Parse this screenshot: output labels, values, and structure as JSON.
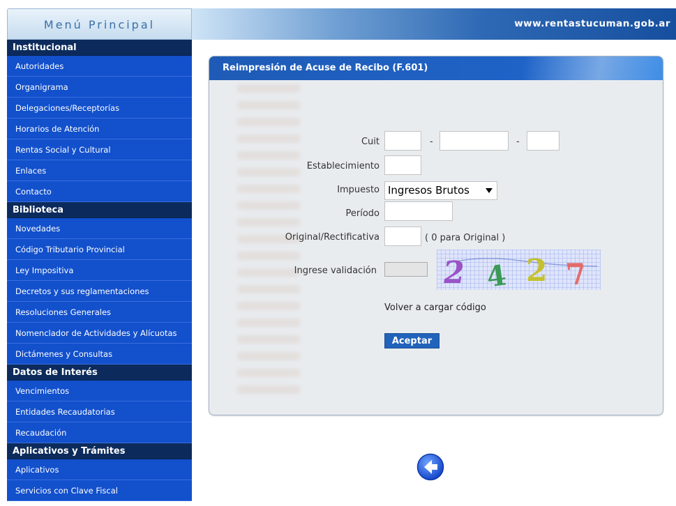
{
  "header": {
    "menu_title": "Menú Principal",
    "site_url": "www.rentastucuman.gob.ar"
  },
  "sidebar": {
    "sections": [
      {
        "title": "Institucional",
        "items": [
          "Autoridades",
          "Organigrama",
          "Delegaciones/Receptorías",
          "Horarios de Atención",
          "Rentas Social y Cultural",
          "Enlaces",
          "Contacto"
        ]
      },
      {
        "title": "Biblioteca",
        "items": [
          "Novedades",
          "Código Tributario Provincial",
          "Ley Impositiva",
          "Decretos y sus reglamentaciones",
          "Resoluciones Generales",
          "Nomenclador de Actividades y Alícuotas",
          "Dictámenes y Consultas"
        ]
      },
      {
        "title": "Datos de Interés",
        "items": [
          "Vencimientos",
          "Entidades Recaudatorias",
          "Recaudación"
        ]
      },
      {
        "title": "Aplicativos y Trámites",
        "items": [
          "Aplicativos",
          "Servicios con Clave Fiscal"
        ]
      }
    ]
  },
  "form": {
    "title": "Reimpresión de Acuse de Recibo (F.601)",
    "cuit_label": "Cuit",
    "cuit_separator": "-",
    "establecimiento_label": "Establecimiento",
    "impuesto_label": "Impuesto",
    "impuesto_value": "Ingresos Brutos",
    "periodo_label": "Período",
    "original_label": "Original/Rectificativa",
    "original_hint": "( 0 para Original )",
    "validacion_label": "Ingrese validación",
    "captcha_text": "2427",
    "reload_label": "Volver a cargar código",
    "accept_label": "Aceptar"
  },
  "colors": {
    "section_bg": "#0c2b5c",
    "item_bg": "#1250cc",
    "panel_head": "#1f5bb6",
    "accent_button": "#2163bb"
  },
  "icons": {
    "back": "back-arrow-icon"
  }
}
